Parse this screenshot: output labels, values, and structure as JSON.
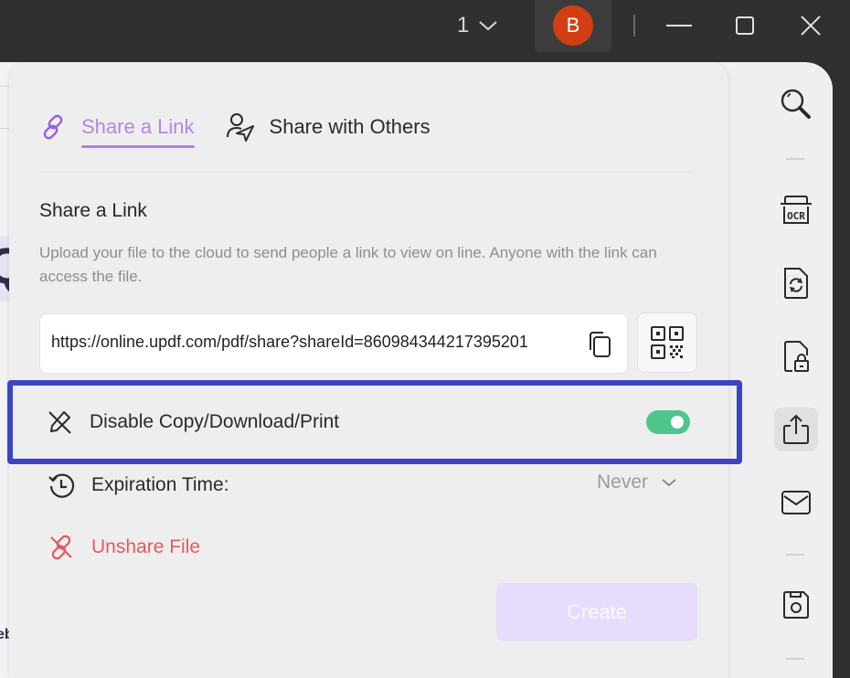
{
  "titlebar": {
    "page_number": "1",
    "avatar_initial": "B",
    "avatar_color": "#d13f12"
  },
  "share_panel": {
    "tabs": [
      {
        "label": "Share a Link",
        "icon": "link-icon",
        "active": true
      },
      {
        "label": "Share with Others",
        "icon": "user-send-icon",
        "active": false
      }
    ],
    "section_title": "Share a Link",
    "description": "Upload your file to the cloud to send people a link to view on line. Anyone with the link can access the file.",
    "link_value": "https://online.updf.com/pdf/share?shareId=860984344217395201",
    "options": {
      "disable_copy_label": "Disable Copy/Download/Print",
      "disable_copy_enabled": true,
      "expiration_label": "Expiration Time:",
      "expiration_value": "Never",
      "unshare_label": "Unshare File"
    },
    "create_label": "Create"
  },
  "colors": {
    "accent": "#b685e8",
    "highlight_border": "#3d44c4",
    "toggle_on": "#4fc58b",
    "danger": "#e45a5d",
    "create_disabled": "#e8dcfd"
  },
  "right_rail": {
    "items": [
      {
        "name": "search",
        "icon": "search-icon"
      },
      {
        "name": "ocr",
        "icon": "ocr-icon"
      },
      {
        "name": "convert",
        "icon": "file-convert-icon"
      },
      {
        "name": "protect",
        "icon": "file-lock-icon"
      },
      {
        "name": "share",
        "icon": "share-icon",
        "active": true
      },
      {
        "name": "email",
        "icon": "mail-icon"
      },
      {
        "name": "save",
        "icon": "save-icon"
      }
    ]
  },
  "background_doc": {
    "glyph_large": "Q",
    "glyph_small": "eb"
  }
}
